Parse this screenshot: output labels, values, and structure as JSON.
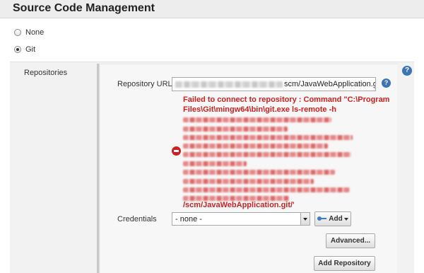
{
  "section": {
    "title": "Source Code Management"
  },
  "scm_options": [
    {
      "label": "None",
      "selected": false
    },
    {
      "label": "Git",
      "selected": true
    }
  ],
  "repositories": {
    "label": "Repositories",
    "url_label": "Repository URL",
    "url_visible_suffix": "scm/JavaWebApplication.git",
    "error": {
      "line1": "Failed to connect to repository : Command \"C:\\Program",
      "line2": "Files\\Git\\mingw64\\bin\\git.exe ls-remote -h",
      "last_line": "/scm/JavaWebApplication.git/'"
    },
    "credentials_label": "Credentials",
    "credentials_value": "- none -",
    "add_label": "Add",
    "advanced_label": "Advanced...",
    "add_repository_label": "Add Repository"
  },
  "icons": {
    "help": "?"
  },
  "colors": {
    "error": "#d01f1f",
    "help": "#3d74b8"
  }
}
